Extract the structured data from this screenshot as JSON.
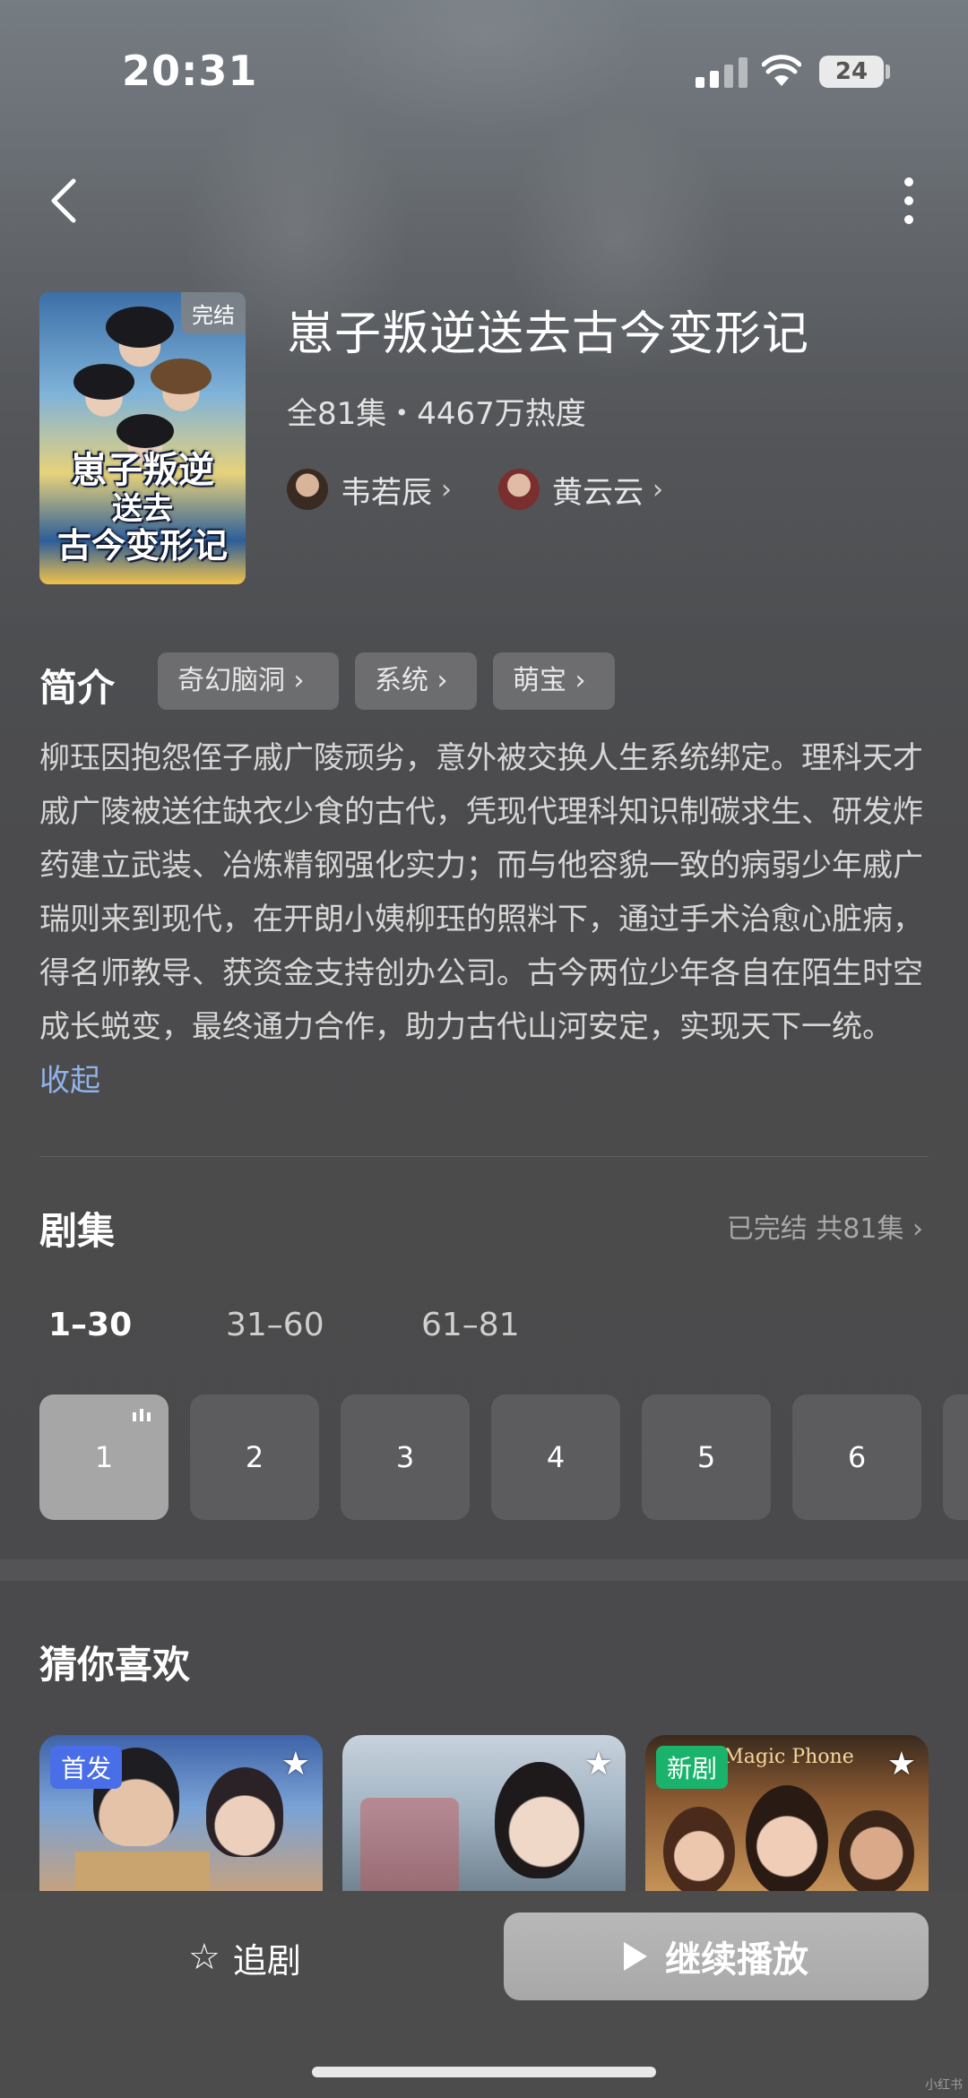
{
  "status_bar": {
    "time": "20:31",
    "battery": "24"
  },
  "drama": {
    "title": "崽子叛逆送去古今变形记",
    "meta": "全81集・4467万热度",
    "status_badge": "完结",
    "poster_title_line1": "崽子叛逆",
    "poster_title_line2": "送去",
    "poster_title_line3": "古今变形记",
    "actors": [
      {
        "name": "韦若辰",
        "chevron": "›"
      },
      {
        "name": "黄云云",
        "chevron": "›"
      }
    ]
  },
  "synopsis": {
    "heading": "简介",
    "tags": [
      "奇幻脑洞 ›",
      "系统 ›",
      "萌宝 ›"
    ],
    "text": "柳珏因抱怨侄子戚广陵顽劣，意外被交换人生系统绑定。理科天才戚广陵被送往缺衣少食的古代，凭现代理科知识制碳求生、研发炸药建立武装、冶炼精钢强化实力；而与他容貌一致的病弱少年戚广瑞则来到现代，在开朗小姨柳珏的照料下，通过手术治愈心脏病，得名师教导、获资金支持创办公司。古今两位少年各自在陌生时空成长蜕变，最终通力合作，助力古代山河安定，实现天下一统。",
    "collapse": "收起"
  },
  "episodes": {
    "heading": "剧集",
    "status": "已完结 共81集 ›",
    "ranges": [
      "1–30",
      "31–60",
      "61–81"
    ],
    "items": [
      "1",
      "2",
      "3",
      "4",
      "5",
      "6"
    ]
  },
  "recommend": {
    "heading": "猜你喜欢",
    "cards": [
      {
        "badge": "首发",
        "badge_color": "#4a6ee8"
      },
      {
        "badge": ""
      },
      {
        "badge": "新剧",
        "badge_color": "#19b36b",
        "poster_text": "Magic Phone"
      }
    ]
  },
  "bottom": {
    "follow_icon": "☆",
    "follow_label": "追剧",
    "play_label": "继续播放"
  },
  "watermark": "小红书"
}
